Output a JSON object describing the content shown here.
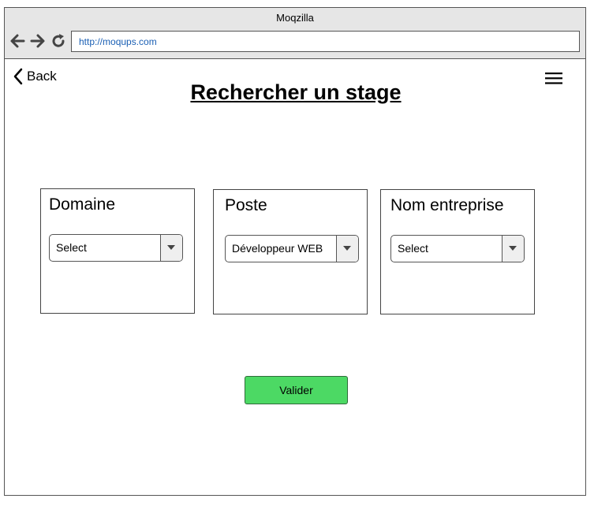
{
  "browser": {
    "title": "Moqzilla",
    "url": "http://moqups.com"
  },
  "nav": {
    "back_label": "Back"
  },
  "page": {
    "title": "Rechercher un stage"
  },
  "filters": [
    {
      "label": "Domaine",
      "selected": "Select"
    },
    {
      "label": "Poste",
      "selected": "Développeur WEB"
    },
    {
      "label": "Nom entreprise",
      "selected": "Select"
    }
  ],
  "actions": {
    "submit_label": "Valider"
  },
  "colors": {
    "submit_bg": "#4cd964",
    "url_text": "#1a5fb4"
  }
}
